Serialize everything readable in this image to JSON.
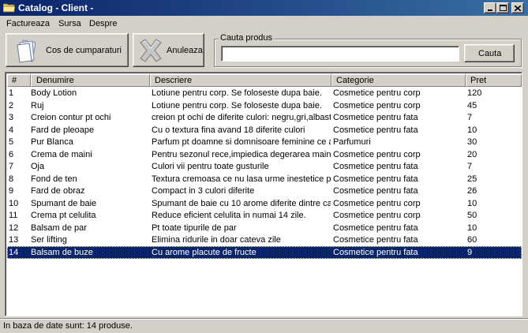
{
  "window": {
    "title": "Catalog - Client -"
  },
  "menu": [
    "Factureaza",
    "Sursa",
    "Despre"
  ],
  "toolbar": {
    "cart_label": "Cos de cumparaturi",
    "cancel_label": "Anuleaza",
    "search_group_label": "Cauta produs",
    "search_value": "",
    "search_button_label": "Cauta"
  },
  "table": {
    "columns": [
      "#",
      "Denumire",
      "Descriere",
      "Categorie",
      "Pret"
    ],
    "rows": [
      [
        "1",
        "Body Lotion",
        "Lotiune pentru corp. Se foloseste dupa baie.",
        "Cosmetice pentru corp",
        "120"
      ],
      [
        "2",
        "Ruj",
        "Lotiune pentru corp. Se foloseste dupa baie.",
        "Cosmetice pentru corp",
        "45"
      ],
      [
        "3",
        "Creion contur pt ochi",
        "creion pt ochi de diferite culori: negru,gri,albastru",
        "Cosmetice pentru fata",
        "7"
      ],
      [
        "4",
        "Fard de pleoape",
        "Cu o textura fina avand 18 diferite culori",
        "Cosmetice pentru fata",
        "10"
      ],
      [
        "5",
        "Pur Blanca",
        "Parfum pt doamne si domnisoare feminine ce adora",
        "Parfumuri",
        "30"
      ],
      [
        "6",
        "Crema de maini",
        "Pentru sezonul rece,impiedica degerarea mainilor",
        "Cosmetice pentru corp",
        "20"
      ],
      [
        "7",
        "Oja",
        "Culori vii pentru toate gusturile",
        "Cosmetice pentru fata",
        "7"
      ],
      [
        "8",
        "Fond de ten",
        "Textura cremoasa ce nu lasa urme inestetice pe",
        "Cosmetice pentru fata",
        "25"
      ],
      [
        "9",
        "Fard de obraz",
        "Compact in 3 culori diferite",
        "Cosmetice pentru fata",
        "26"
      ],
      [
        "10",
        "Spumant de baie",
        "Spumant de baie cu 10 arome diferite dintre care",
        "Cosmetice pentru corp",
        "10"
      ],
      [
        "11",
        "Crema pt celulita",
        "Reduce eficient celulita in numai 14 zile.",
        "Cosmetice pentru corp",
        "50"
      ],
      [
        "12",
        "Balsam de par",
        "Pt toate tipurile de par",
        "Cosmetice pentru fata",
        "10"
      ],
      [
        "13",
        "Ser lifting",
        "Elimina ridurile in doar cateva zile",
        "Cosmetice pentru fata",
        "60"
      ],
      [
        "14",
        "Balsam de buze",
        "Cu arome placute de fructe",
        "Cosmetice pentru fata",
        "9"
      ]
    ],
    "selected_row": 13
  },
  "status": {
    "text": "In baza de date sunt: 14 produse."
  },
  "colors": {
    "titlebar": "#0a246a",
    "selection": "#0a246a",
    "face": "#d4d0c8"
  },
  "icons": {
    "app": "folder-icon",
    "cart": "document-stack-icon",
    "cancel": "close-x-icon"
  }
}
